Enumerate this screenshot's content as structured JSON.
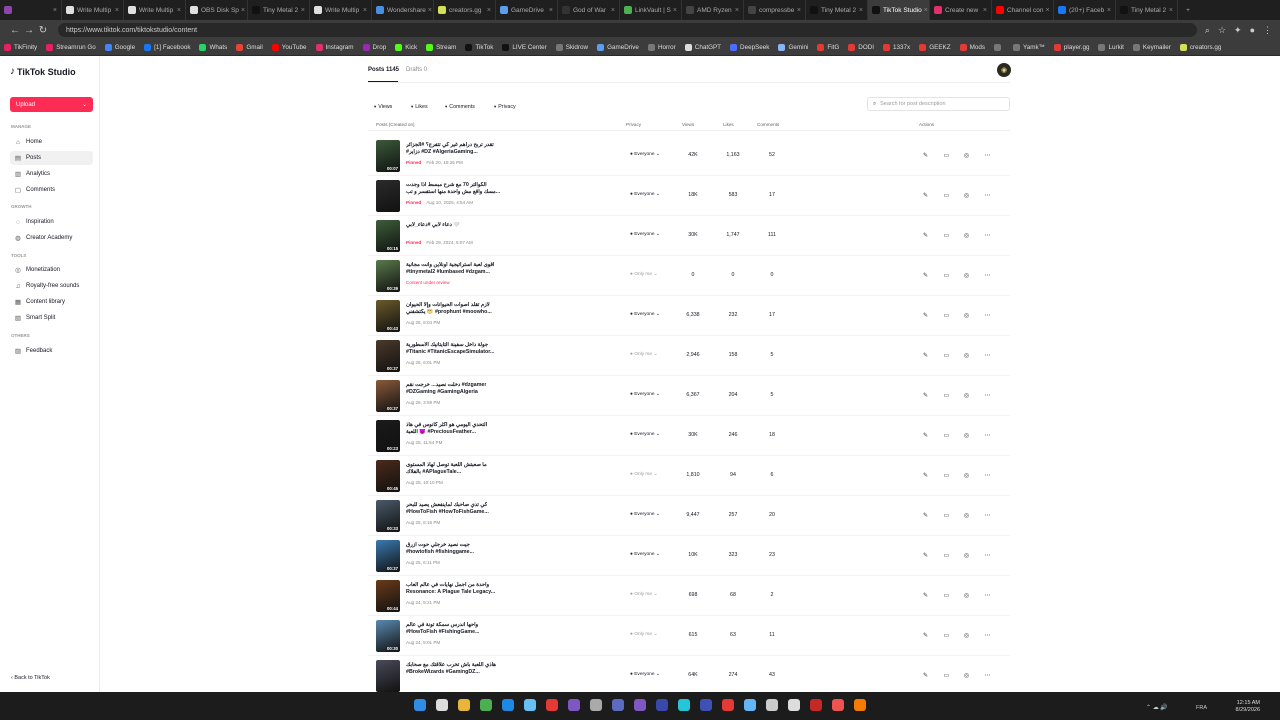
{
  "browser": {
    "tabs": [
      {
        "label": "",
        "icon": "chrome-icon",
        "color": "#8e44ad"
      },
      {
        "label": "Write Multip",
        "icon": "openai-icon",
        "color": "#e0e0e0"
      },
      {
        "label": "Write Multip",
        "icon": "openai-icon",
        "color": "#e0e0e0"
      },
      {
        "label": "OBS Disk Sp",
        "icon": "openai-icon",
        "color": "#e0e0e0"
      },
      {
        "label": "Tiny Metal 2",
        "icon": "tiktok-icon",
        "color": "#111111"
      },
      {
        "label": "Write Multip",
        "icon": "openai-icon",
        "color": "#e0e0e0"
      },
      {
        "label": "Wondershare",
        "icon": "wondershare-icon",
        "color": "#4a90e2"
      },
      {
        "label": "creators.gg",
        "icon": "creators-icon",
        "color": "#d4e157"
      },
      {
        "label": "GameDrive",
        "icon": "gamedrive-icon",
        "color": "#5c9ded"
      },
      {
        "label": "God of War",
        "icon": "godofwar-icon",
        "color": "#333333"
      },
      {
        "label": "LinkVault | S",
        "icon": "linkvault-icon",
        "color": "#4caf50"
      },
      {
        "label": "AMD Ryzen",
        "icon": "amd-icon",
        "color": "#444444"
      },
      {
        "label": "compressbe",
        "icon": "compress-icon",
        "color": "#444444"
      },
      {
        "label": "Tiny Metal 2",
        "icon": "tiktok-icon",
        "color": "#111111"
      },
      {
        "label": "TikTok Studio",
        "icon": "tiktok-icon",
        "color": "#111111"
      },
      {
        "label": "Create new",
        "icon": "instagram-icon",
        "color": "#e1306c"
      },
      {
        "label": "Channel con",
        "icon": "youtube-icon",
        "color": "#ff0000"
      },
      {
        "label": "(20+) Faceb",
        "icon": "facebook-icon",
        "color": "#1877f2"
      },
      {
        "label": "Tiny Metal 2",
        "icon": "tiktok-icon",
        "color": "#111111"
      }
    ],
    "active_tab": 14,
    "new_tab": "+",
    "url": "https://www.tiktok.com/tiktokstudio/content",
    "bookmarks": [
      {
        "label": "TikFinity",
        "color": "#e91e63"
      },
      {
        "label": "Streamrun Go",
        "color": "#e91e63"
      },
      {
        "label": "Google",
        "color": "#4285f4"
      },
      {
        "label": "[1] Facebook",
        "color": "#1877f2"
      },
      {
        "label": "Whats",
        "color": "#25d366"
      },
      {
        "label": "Gmail",
        "color": "#ea4335"
      },
      {
        "label": "YouTube",
        "color": "#ff0000"
      },
      {
        "label": "Instagram",
        "color": "#e1306c"
      },
      {
        "label": "Drop",
        "color": "#9c27b0"
      },
      {
        "label": "Kick",
        "color": "#53fc18"
      },
      {
        "label": "Stream",
        "color": "#53fc18"
      },
      {
        "label": "TikTok",
        "color": "#111111"
      },
      {
        "label": "LIVE Center",
        "color": "#111111"
      },
      {
        "label": "Skidrow",
        "color": "#777777"
      },
      {
        "label": "GameDrive",
        "color": "#5c9ded"
      },
      {
        "label": "Horror",
        "color": "#777777"
      },
      {
        "label": "ChatGPT",
        "color": "#dddddd"
      },
      {
        "label": "DeepSeek",
        "color": "#4d6bfe"
      },
      {
        "label": "Gemini",
        "color": "#8ab4f8"
      },
      {
        "label": "FitG",
        "color": "#e53935"
      },
      {
        "label": "DODI",
        "color": "#e53935"
      },
      {
        "label": "1337x",
        "color": "#e53935"
      },
      {
        "label": "GEEKZ",
        "color": "#e53935"
      },
      {
        "label": "Mods",
        "color": "#e53935"
      },
      {
        "label": "",
        "color": "#777777"
      },
      {
        "label": "Yamk™",
        "color": "#777777"
      },
      {
        "label": "player.gg",
        "color": "#e53935"
      },
      {
        "label": "Lurkit",
        "color": "#777777"
      },
      {
        "label": "Keymailer",
        "color": "#777777"
      },
      {
        "label": "creators.gg",
        "color": "#d4e157"
      }
    ]
  },
  "sidebar": {
    "logo": "TikTok Studio",
    "upload": "Upload",
    "sections": {
      "manage": "MANAGE",
      "growth": "GROWTH",
      "tools": "TOOLS",
      "others": "OTHERS"
    },
    "items": [
      {
        "label": "Home",
        "icon": "home-icon"
      },
      {
        "label": "Posts",
        "icon": "posts-icon"
      },
      {
        "label": "Analytics",
        "icon": "analytics-icon"
      },
      {
        "label": "Comments",
        "icon": "comments-icon"
      },
      {
        "label": "Inspiration",
        "icon": "inspiration-icon"
      },
      {
        "label": "Creator Academy",
        "icon": "academy-icon"
      },
      {
        "label": "Monetization",
        "icon": "monetization-icon"
      },
      {
        "label": "Royalty-free sounds",
        "icon": "music-icon"
      },
      {
        "label": "Content library",
        "icon": "library-icon"
      },
      {
        "label": "Smart Split",
        "icon": "split-icon"
      },
      {
        "label": "Feedback",
        "icon": "feedback-icon"
      }
    ],
    "active_item": 1,
    "back": "Back to TikTok"
  },
  "main": {
    "tabs": {
      "posts": "Posts 1145",
      "drafts": "Drafts 0"
    },
    "filters": [
      "Views",
      "Likes",
      "Comments",
      "Privacy"
    ],
    "search_placeholder": "Search for post description",
    "columns": {
      "posts": "Posts (Created on)",
      "privacy": "Privacy",
      "views": "Views",
      "likes": "Likes",
      "comments": "Comments",
      "actions": "Actions"
    },
    "rows": [
      {
        "cap1": "تقدر تربح دراهم غير كي تتفرج؟ #الجزائر",
        "cap2": "#دزاير #DZ #AlgeriaGaming...",
        "tag": "Pinned",
        "date": "Feb 20, 10:26 PM",
        "privacy": "Everyone",
        "views": "42K",
        "likes": "1,163",
        "comments": "52",
        "dur": "00:07",
        "color": "#3c5a3a"
      },
      {
        "cap1": "الكوالتر 70 مع شرح مبسط اذا وجدت",
        "cap2": "مسك واقع مش واحدة منها استفسر و تب...",
        "tag": "Pinned",
        "date": "Aug 10, 2025, 4:54 AM",
        "privacy": "Everyone",
        "views": "18K",
        "likes": "583",
        "comments": "17",
        "dur": "",
        "color": "#2b2b2b"
      },
      {
        "cap1": "دعاء لأبي #دعاء_لأبي 🤍",
        "cap2": "",
        "tag": "Pinned",
        "date": "Feb 29, 2024, 5:07 AM",
        "privacy": "Everyone",
        "views": "30K",
        "likes": "1,747",
        "comments": "111",
        "dur": "00:15",
        "color": "#3d5e3a"
      },
      {
        "cap1": "أقوى لعبة استراتيجية أونلاين وأنت مجانية",
        "cap2": "#tinymetal2 #lumbased #dzgam...",
        "tag": "Content under review",
        "date": "",
        "privacy": "Only me",
        "views": "0",
        "likes": "0",
        "comments": "0",
        "dur": "00:39",
        "color": "#5a7a4a"
      },
      {
        "cap1": "لازم تقلد أصوات الحيوانات وإلا الحيوان",
        "cap2": "يكتشفني 😬 #prophunt #moowho...",
        "tag": "",
        "date": "Aug 26, 8:04 PM",
        "privacy": "Everyone",
        "views": "6,338",
        "likes": "232",
        "comments": "17",
        "dur": "00:43",
        "color": "#6b5a2a"
      },
      {
        "cap1": "جولة داخل سفينة التايتانيك الأسطورية",
        "cap2": "#Titanic #TitanicEscapeSimulator...",
        "tag": "",
        "date": "Aug 26, 6:01 PM",
        "privacy": "Only me",
        "views": "2,946",
        "likes": "158",
        "comments": "5",
        "dur": "00:37",
        "color": "#4a3a2a"
      },
      {
        "cap1": "دخلت نصيد... خرجت نقم #dzgamer",
        "cap2": "#DZGaming #GamingAlgeria",
        "tag": "",
        "date": "Aug 26, 3:59 PM",
        "privacy": "Everyone",
        "views": "6,367",
        "likes": "204",
        "comments": "5",
        "dur": "00:37",
        "color": "#8a5a3a"
      },
      {
        "cap1": "التحدي اليومي هو أكثر كانوس في هاذ",
        "cap2": "اللعبة 😈 #PreciousFeather...",
        "tag": "",
        "date": "Aug 25, 11:54 PM",
        "privacy": "Everyone",
        "views": "30K",
        "likes": "246",
        "comments": "18",
        "dur": "00:23",
        "color": "#1a1a1a"
      },
      {
        "cap1": "ما صعبتش اللعبة توصل لهاذ المستوى",
        "cap2": "بالفلاك #APlagueTale...",
        "tag": "",
        "date": "Aug 25, 10:10 PM",
        "privacy": "Only me",
        "views": "1,810",
        "likes": "94",
        "comments": "6",
        "dur": "00:45",
        "color": "#4a2a1a"
      },
      {
        "cap1": "كي تدي صاحبك لماينفعش يصيد للبحر",
        "cap2": "#HowToFish #HowToFishGame...",
        "tag": "",
        "date": "Aug 25, 8:16 PM",
        "privacy": "Everyone",
        "views": "9,447",
        "likes": "257",
        "comments": "20",
        "dur": "00:33",
        "color": "#4a5a6a"
      },
      {
        "cap1": "جيت نصيد خرجلي حوت أزرق",
        "cap2": "#howtofish #fishinggame...",
        "tag": "",
        "date": "Aug 25, 6:11 PM",
        "privacy": "Everyone",
        "views": "10K",
        "likes": "323",
        "comments": "23",
        "dur": "00:37",
        "color": "#3a7ab0"
      },
      {
        "cap1": "واحدة من أجمل نهايات في عالم ألعاب",
        "cap2": "Resonance: A Plague Tale Legacy...",
        "tag": "",
        "date": "Aug 24, 9:21 PM",
        "privacy": "Only me",
        "views": "698",
        "likes": "68",
        "comments": "2",
        "dur": "00:44",
        "color": "#6a3a1a"
      },
      {
        "cap1": "واحها أندرس سمكة تونة في عالم",
        "cap2": "#HowToFish #FishingGame...",
        "tag": "",
        "date": "Aug 24, 9:01 PM",
        "privacy": "Only me",
        "views": "615",
        "likes": "63",
        "comments": "11",
        "dur": "00:30",
        "color": "#5a8ab0"
      },
      {
        "cap1": "هاذي اللعبة باش تخرب علاقتك مع صحابك",
        "cap2": "#BrokeWizards #GamingDZ...",
        "tag": "",
        "date": "",
        "privacy": "Everyone",
        "views": "64K",
        "likes": "274",
        "comments": "43",
        "dur": "",
        "color": "#4a4a5a"
      }
    ]
  },
  "taskbar": {
    "lang": "FRA",
    "time": "12:15 AM",
    "date": "8/29/2026"
  }
}
